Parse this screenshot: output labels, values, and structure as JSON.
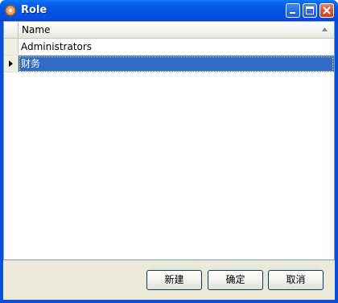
{
  "window": {
    "title": "Role",
    "controls": {
      "minimize": "minimize-icon",
      "maximize": "maximize-icon",
      "close": "close-icon"
    }
  },
  "grid": {
    "column_header": "Name",
    "sort": "ascending",
    "rows": [
      {
        "name": "Administrators",
        "selected": false
      },
      {
        "name": "财务",
        "selected": true
      }
    ]
  },
  "buttons": {
    "new_label": "新建",
    "ok_label": "确定",
    "cancel_label": "取消"
  },
  "colors": {
    "titlebar": "#0553e0",
    "selection": "#316ac5",
    "client_bg": "#ece9d8"
  }
}
